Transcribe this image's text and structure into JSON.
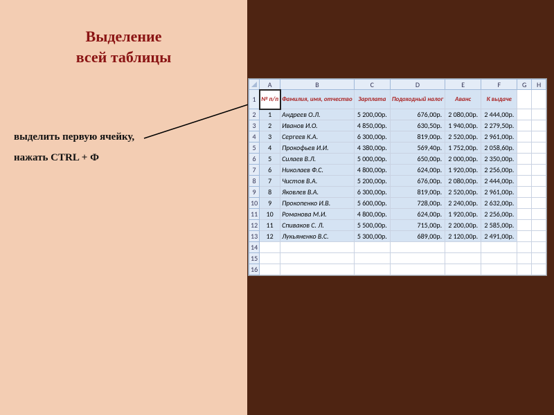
{
  "title_line1": "Выделение",
  "title_line2": "всей таблицы",
  "instr1": "выделить первую ячейку,",
  "instr2": "нажать CTRL + Ф",
  "col_letters": [
    "A",
    "B",
    "C",
    "D",
    "E",
    "F",
    "G",
    "H"
  ],
  "header": {
    "num": "№ п/п",
    "fio": "Фамилия, имя, отчество",
    "salary": "Зарплата",
    "tax": "Подоходный налог",
    "advance": "Аванс",
    "payout": "К выдаче"
  },
  "rows": [
    {
      "n": "1",
      "fio": "Андреев О.Л.",
      "sal": "5 200,00р.",
      "tax": "676,00р.",
      "adv": "2 080,00р.",
      "pay": "2 444,00р."
    },
    {
      "n": "2",
      "fio": "Иванов И.О.",
      "sal": "4 850,00р.",
      "tax": "630,50р.",
      "adv": "1 940,00р.",
      "pay": "2 279,50р."
    },
    {
      "n": "3",
      "fio": "Сергеев К.А.",
      "sal": "6 300,00р.",
      "tax": "819,00р.",
      "adv": "2 520,00р.",
      "pay": "2 961,00р."
    },
    {
      "n": "4",
      "fio": "Прокофьев И.И.",
      "sal": "4 380,00р.",
      "tax": "569,40р.",
      "adv": "1 752,00р.",
      "pay": "2 058,60р."
    },
    {
      "n": "5",
      "fio": "Силаев В.Л.",
      "sal": "5 000,00р.",
      "tax": "650,00р.",
      "adv": "2 000,00р.",
      "pay": "2 350,00р."
    },
    {
      "n": "6",
      "fio": "Николаев Ф.С.",
      "sal": "4 800,00р.",
      "tax": "624,00р.",
      "adv": "1 920,00р.",
      "pay": "2 256,00р."
    },
    {
      "n": "7",
      "fio": "Чистов В.А.",
      "sal": "5 200,00р.",
      "tax": "676,00р.",
      "adv": "2 080,00р.",
      "pay": "2 444,00р."
    },
    {
      "n": "8",
      "fio": "Яковлев В.А.",
      "sal": "6 300,00р.",
      "tax": "819,00р.",
      "adv": "2 520,00р.",
      "pay": "2 961,00р."
    },
    {
      "n": "9",
      "fio": "Прокопенко И.В.",
      "sal": "5 600,00р.",
      "tax": "728,00р.",
      "adv": "2 240,00р.",
      "pay": "2 632,00р."
    },
    {
      "n": "10",
      "fio": "Романова М.И.",
      "sal": "4 800,00р.",
      "tax": "624,00р.",
      "adv": "1 920,00р.",
      "pay": "2 256,00р."
    },
    {
      "n": "11",
      "fio": "Спиваков С. Л.",
      "sal": "5 500,00р.",
      "tax": "715,00р.",
      "adv": "2 200,00р.",
      "pay": "2 585,00р."
    },
    {
      "n": "12",
      "fio": "Лукьяненко В.С.",
      "sal": "5 300,00р.",
      "tax": "689,00р.",
      "adv": "2 120,00р.",
      "pay": "2 491,00р."
    }
  ],
  "empty_rows": [
    "14",
    "15",
    "16"
  ]
}
